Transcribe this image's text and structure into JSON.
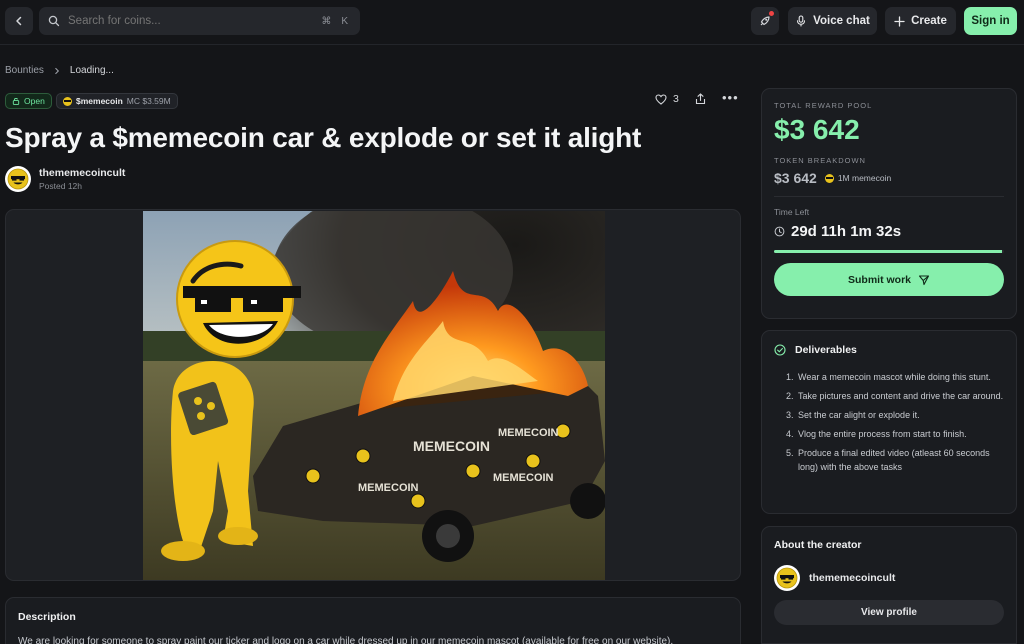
{
  "header": {
    "search_placeholder": "Search for coins...",
    "shortcut_keys": [
      "⌘",
      "K"
    ],
    "voice_chat_label": "Voice chat",
    "create_label": "Create",
    "sign_in_label": "Sign in"
  },
  "breadcrumb": {
    "root": "Bounties",
    "current": "Loading..."
  },
  "bounty": {
    "status": "Open",
    "coin_ticker": "$memecoin",
    "market_cap": "MC $3.59M",
    "likes": "3",
    "title": "Spray a $memecoin car & explode or set it alight",
    "author": "thememecoincult",
    "posted": "Posted 12h",
    "description_heading": "Description",
    "description_text": "We are looking for someone to spray paint our ticker and logo on a car while dressed up in our memecoin mascot (available for free on our website)."
  },
  "reward": {
    "pool_label": "TOTAL REWARD POOL",
    "pool_amount": "$3 642",
    "breakdown_label": "TOKEN BREAKDOWN",
    "breakdown_amount": "$3 642",
    "token_amount": "1M memecoin",
    "time_left_label": "Time Left",
    "time_left": "29d 11h 1m 32s",
    "time_progress_fraction": 0.99,
    "submit_label": "Submit work"
  },
  "deliverables": {
    "heading": "Deliverables",
    "items": [
      "Wear a memecoin mascot while doing this stunt.",
      "Take pictures and content and drive the car around.",
      "Set the car alight or explode it.",
      "Vlog the entire process from start to finish.",
      "Produce a final edited video (atleast 60 seconds long) with the above tasks"
    ]
  },
  "creator": {
    "heading": "About the creator",
    "name": "thememecoincult",
    "view_profile_label": "View profile"
  },
  "photo": {
    "car_text": "MEMECOIN"
  },
  "colors": {
    "accent_green": "#86efac",
    "background": "#141518",
    "card": "#1a1c20",
    "coin_yellow": "#e8c21c"
  }
}
